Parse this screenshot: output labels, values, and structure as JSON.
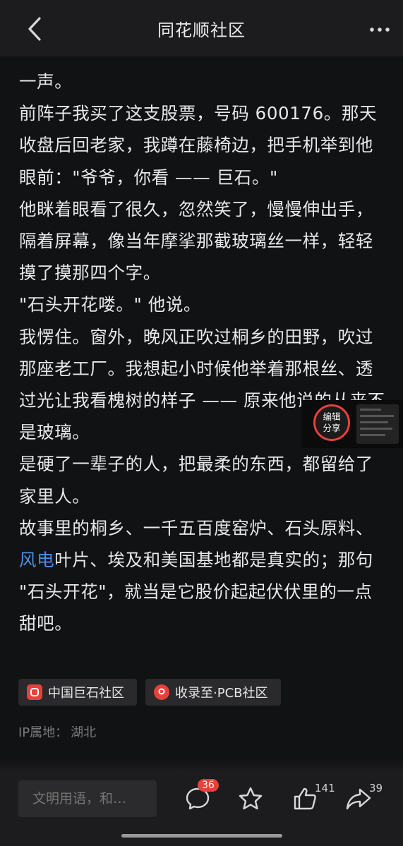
{
  "header": {
    "title": "同花顺社区"
  },
  "article": {
    "p1": "一声。",
    "p2": "前阵子我买了这支股票，号码 600176。那天收盘后回老家，我蹲在藤椅边，把手机举到他眼前：\"爷爷，你看 —— 巨石。\"",
    "p3": "他眯着眼看了很久，忽然笑了，慢慢伸出手，隔着屏幕，像当年摩挲那截玻璃丝一样，轻轻摸了摸那四个字。",
    "p4": "\"石头开花喽。\" 他说。",
    "p5": "我愣住。窗外，晚风正吹过桐乡的田野，吹过那座老工厂。我想起小时候他举着那根丝、透过光让我看槐树的样子 —— 原来他说的从来不是玻璃。",
    "p6": "是硬了一辈子的人，把最柔的东西，都留给了家里人。",
    "p7_before": "故事里的桐乡、一千五百度窑炉、石头原料、",
    "p7_link": "风电",
    "p7_after": "叶片、埃及和美国基地都是真实的；那句 \"石头开花\"，就当是它股价起起伏伏里的一点甜吧。"
  },
  "tags": [
    {
      "label": "中国巨石社区"
    },
    {
      "label": "收录至·PCB社区"
    }
  ],
  "ip": {
    "label": "IP属地：",
    "value": "湖北"
  },
  "floating": {
    "line1": "编辑",
    "line2": "分享"
  },
  "bottom": {
    "comment_placeholder": "文明用语，和…",
    "comment_count": "36",
    "like_count": "141",
    "share_count": "39"
  },
  "colors": {
    "accent": "#e8413a",
    "link": "#4a8fe0",
    "background": "#111214"
  },
  "icons": [
    "back-arrow-icon",
    "more-dots-icon",
    "comment-icon",
    "star-icon",
    "thumbs-up-icon",
    "share-arrow-icon"
  ]
}
